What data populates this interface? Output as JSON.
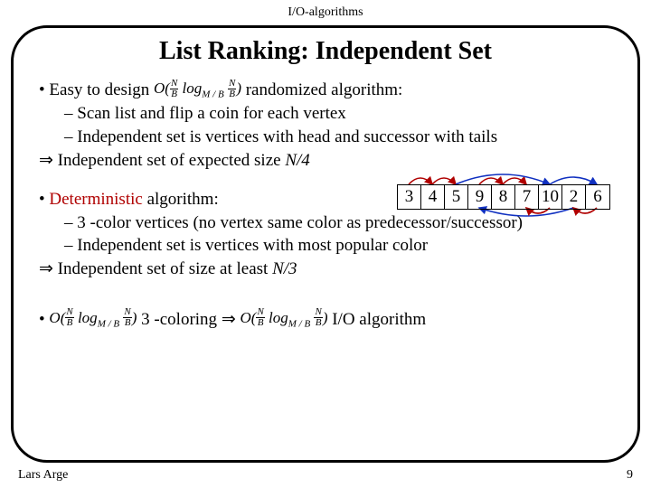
{
  "header": "I/O-algorithms",
  "title": "List Ranking: Independent Set",
  "bullet1_a": "Easy to design ",
  "bullet1_b": " randomized algorithm:",
  "sub1a": "– Scan list and flip a coin for each vertex",
  "sub1b": "– Independent set is vertices with head and successor with tails",
  "imp1_a": "Independent set of expected size ",
  "imp1_b": "N/4",
  "bullet2_a": "Deterministic",
  "bullet2_b": " algorithm:",
  "sub2a": "– 3 -color vertices (no vertex same color as predecessor/successor)",
  "sub2b": "– Independent set is vertices with most popular color",
  "imp2_a": "Independent set of size at least ",
  "imp2_b": "N/3",
  "bullet3_mid": " 3 -coloring ",
  "bullet3_tail": " I/O algorithm",
  "cells": [
    "3",
    "4",
    "5",
    "9",
    "8",
    "7",
    "10",
    "2",
    "6"
  ],
  "footer_left": "Lars Arge",
  "footer_right": "9",
  "formula": {
    "O": "O",
    "lp": "(",
    "rp": ")",
    "N": "N",
    "B": "B",
    "log": "log",
    "MB": "M / B"
  }
}
